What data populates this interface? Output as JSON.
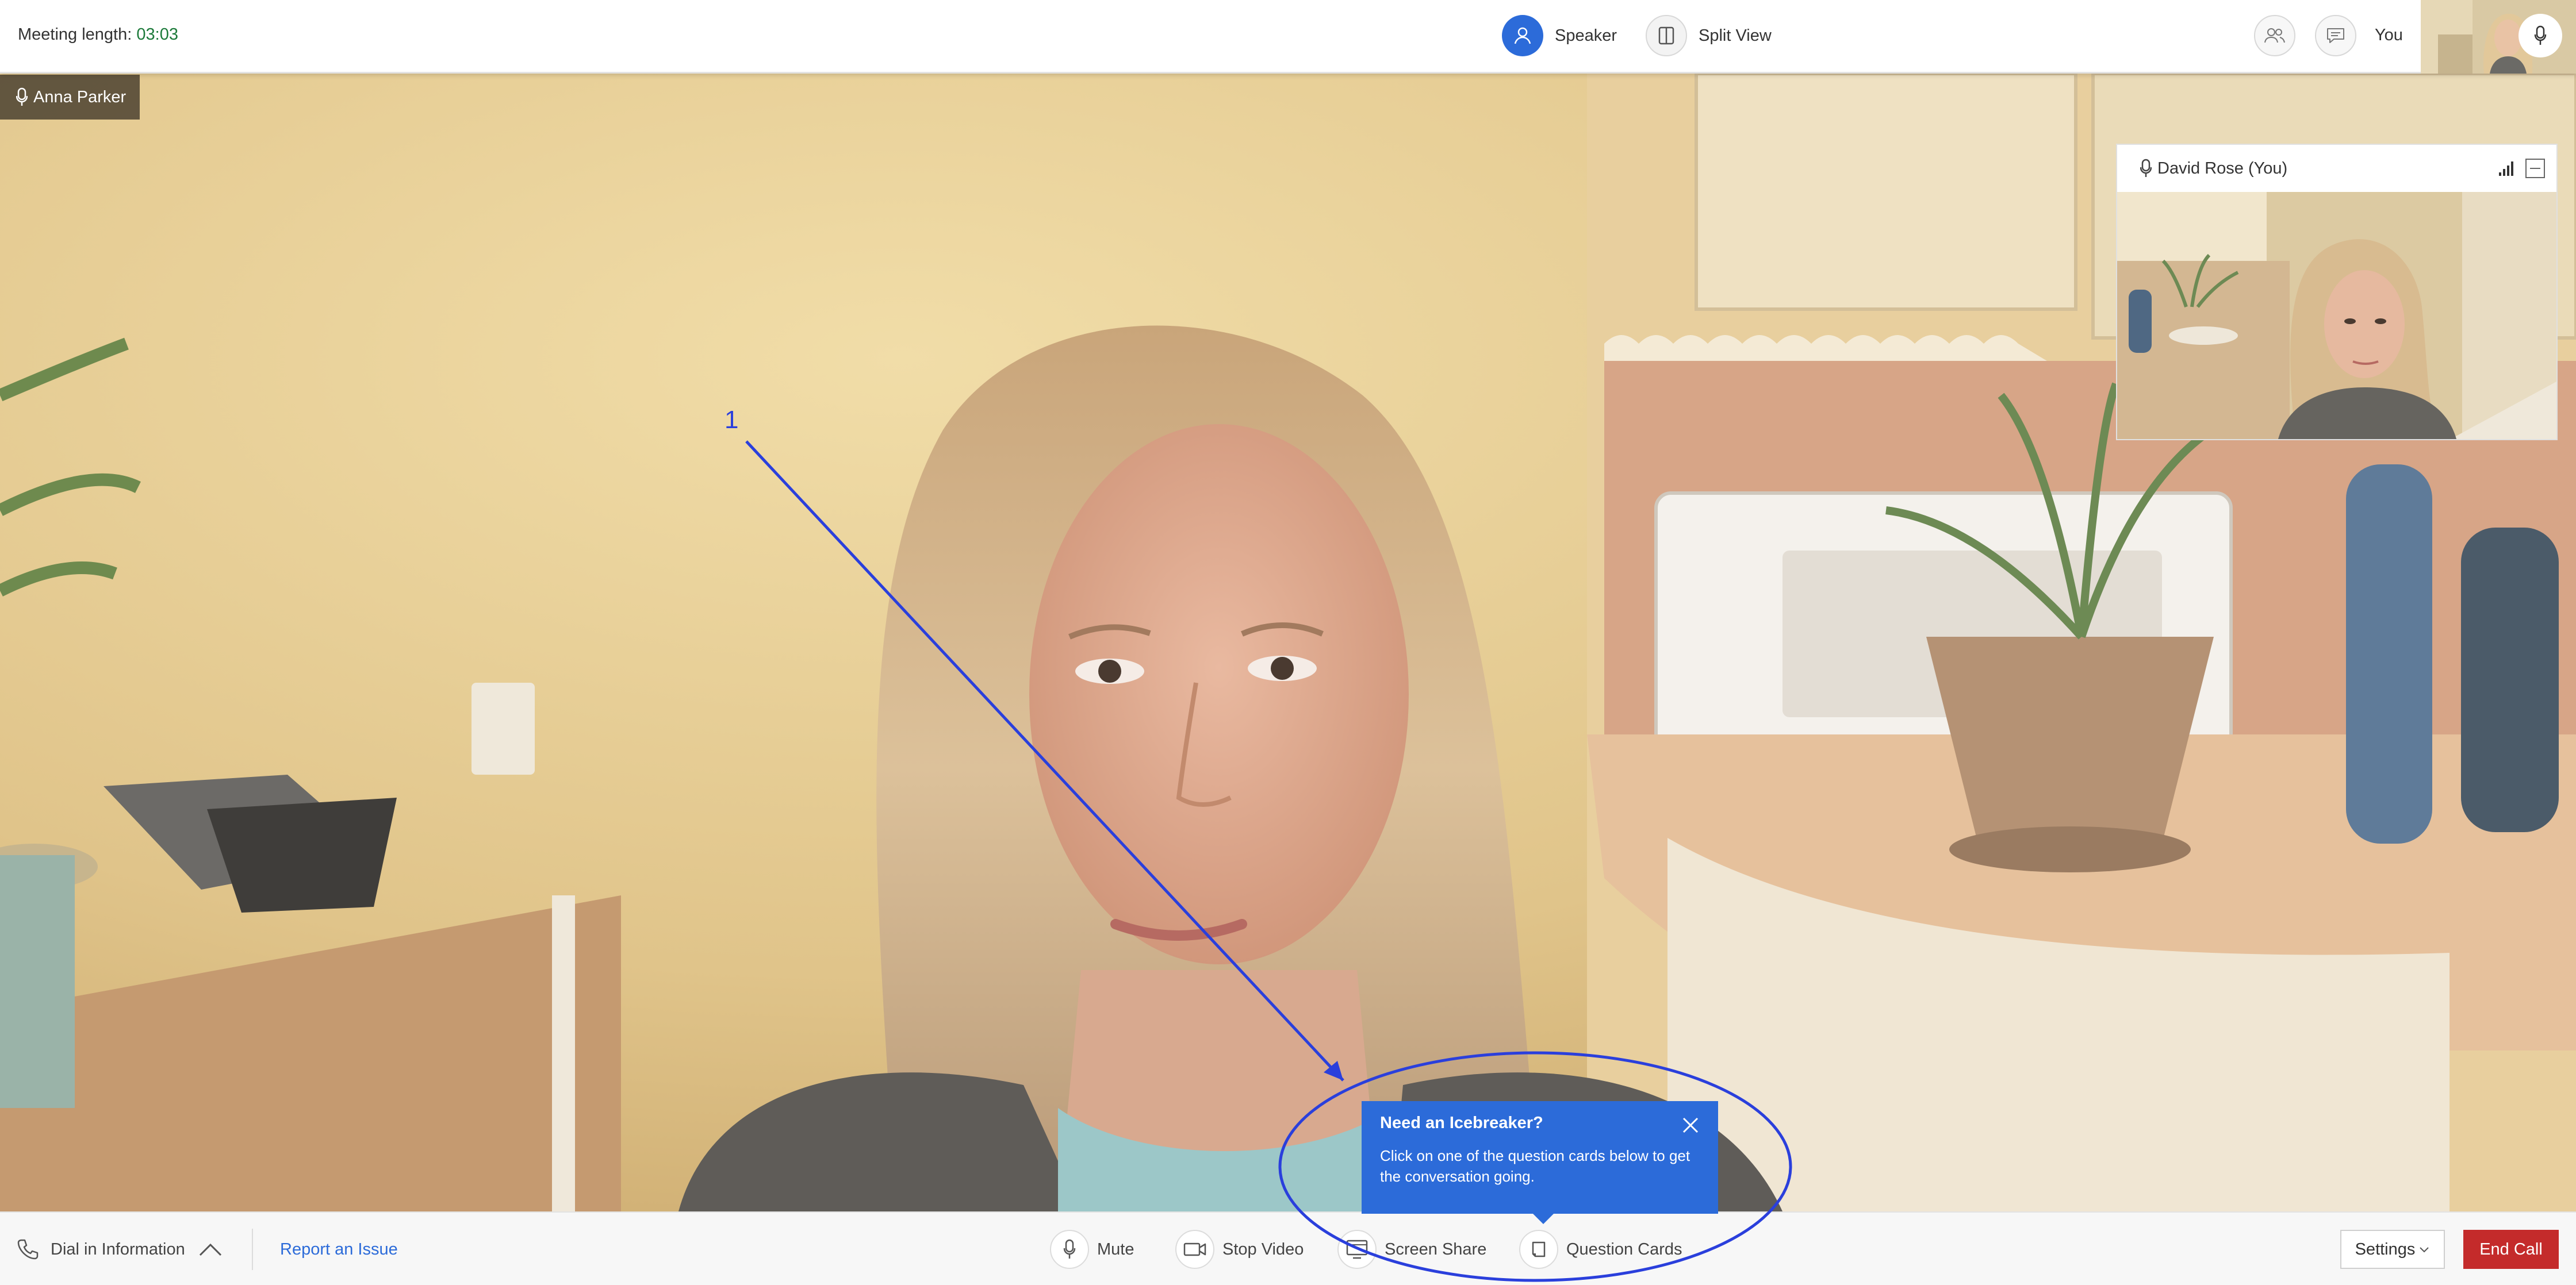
{
  "header": {
    "meeting_length_label": "Meeting length:",
    "meeting_length_value": "03:03",
    "speaker_label": "Speaker",
    "split_view_label": "Split View",
    "you_label": "You",
    "icons": [
      "person-icon",
      "split-view-icon",
      "participants-icon",
      "chat-icon",
      "microphone-icon"
    ]
  },
  "main": {
    "speaker_name": "Anna Parker"
  },
  "self_view": {
    "name": "David Rose (You)",
    "icons": [
      "microphone-icon",
      "signal-strength-icon",
      "minimize-icon"
    ]
  },
  "annotation": {
    "label": "1",
    "color": "#2a3fdc"
  },
  "icebreaker": {
    "title": "Need an Icebreaker?",
    "body": "Click on one of the question cards below to get the conversation going."
  },
  "footer": {
    "dial_in_label": "Dial in Information",
    "report_issue_label": "Report an Issue",
    "mute_label": "Mute",
    "stop_video_label": "Stop Video",
    "screen_share_label": "Screen Share",
    "question_cards_label": "Question Cards",
    "settings_label": "Settings",
    "end_call_label": "End Call"
  },
  "colors": {
    "accent": "#2c6bd9",
    "end_call": "#c42b2b",
    "timer": "#1c7a3a"
  }
}
